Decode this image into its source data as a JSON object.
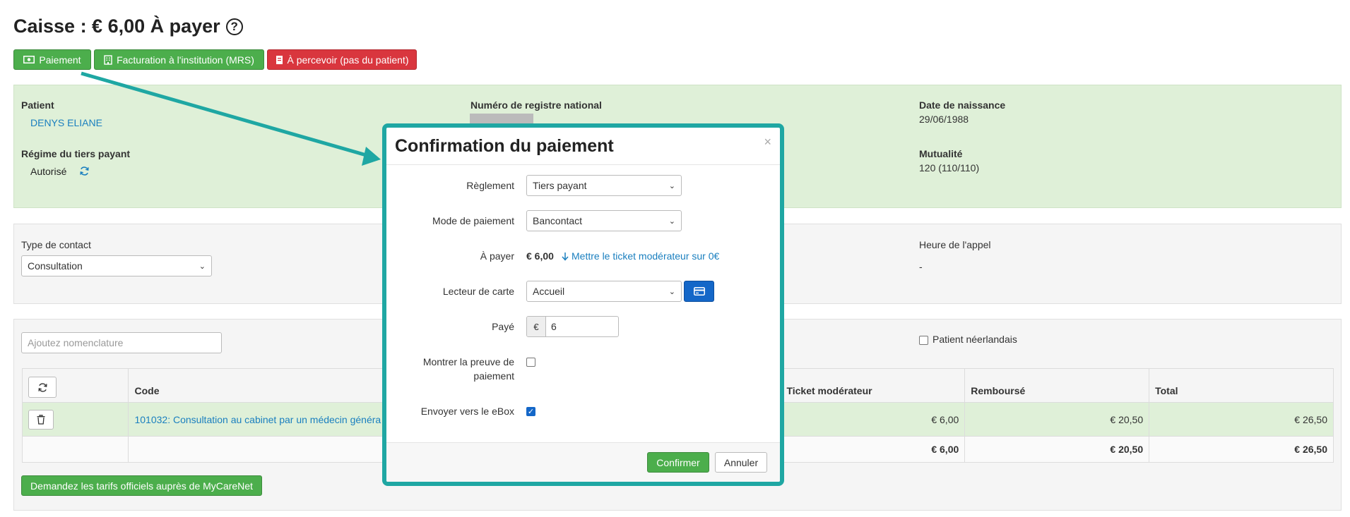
{
  "header": {
    "title": "Caisse : € 6,00 À payer",
    "help": "?"
  },
  "toolbar": {
    "payment": "Paiement",
    "invoice_institution": "Facturation à l'institution (MRS)",
    "to_collect": "À percevoir (pas du patient)"
  },
  "patient": {
    "patient_label": "Patient",
    "patient_name": "DENYS ELIANE",
    "nrn_label": "Numéro de registre national",
    "dob_label": "Date de naissance",
    "dob": "29/06/1988",
    "third_party_label": "Régime du tiers payant",
    "third_party_value": "Autorisé",
    "mutuality_label": "Mutualité",
    "mutuality_value": "120 (110/110)"
  },
  "contact": {
    "type_label": "Type de contact",
    "type_value": "Consultation",
    "call_time_label": "Heure de l'appel",
    "call_time_value": "-"
  },
  "nomenclature": {
    "placeholder": "Ajoutez nomenclature",
    "dutch_patient": "Patient néerlandais",
    "columns": {
      "code": "Code",
      "ticket": "Ticket modérateur",
      "refunded": "Remboursé",
      "total": "Total"
    },
    "row": {
      "code": "101032: Consultation au cabinet par un médecin généra",
      "ticket": "€ 6,00",
      "refunded": "€ 20,50",
      "total": "€ 26,50"
    },
    "totals": {
      "ticket": "€ 6,00",
      "refunded": "€ 20,50",
      "total": "€ 26,50"
    },
    "mycarenet_button": "Demandez les tarifs officiels auprès de MyCareNet"
  },
  "modal": {
    "title": "Confirmation du paiement",
    "close": "×",
    "settlement_label": "Règlement",
    "settlement_value": "Tiers payant",
    "payment_mode_label": "Mode de paiement",
    "payment_mode_value": "Bancontact",
    "to_pay_label": "À payer",
    "to_pay_value": "€ 6,00",
    "ticket_zero_link": "Mettre le ticket modérateur sur 0€",
    "card_reader_label": "Lecteur de carte",
    "card_reader_value": "Accueil",
    "paid_label": "Payé",
    "paid_currency": "€",
    "paid_value": "6",
    "proof_label_1": "Montrer la preuve de",
    "proof_label_2": "paiement",
    "proof_checked": false,
    "ebox_label": "Envoyer vers le eBox",
    "ebox_checked": true,
    "confirm": "Confirmer",
    "cancel": "Annuler"
  },
  "colors": {
    "accent_teal": "#1fa7a3",
    "success_green": "#4cae4c",
    "danger_red": "#d9363e",
    "primary_blue": "#1467c8",
    "link_blue": "#1a7fbf",
    "panel_green": "#dff0d8"
  },
  "icons": {
    "payment": "money-icon",
    "institution": "building-icon",
    "collect": "receipt-icon",
    "refresh": "refresh-icon",
    "delete": "trash-icon",
    "card": "credit-card-icon",
    "arrow_down": "arrow-down-icon"
  }
}
